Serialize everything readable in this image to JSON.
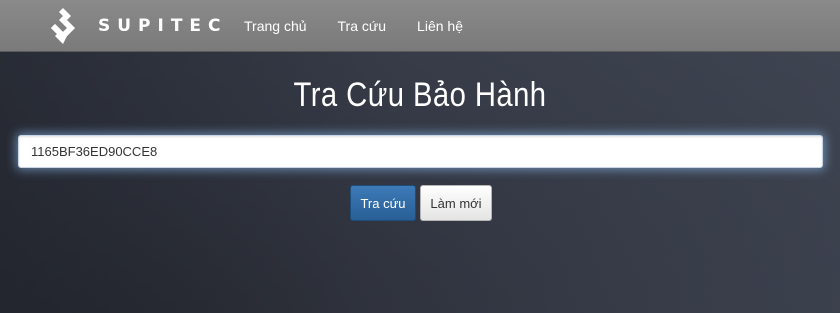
{
  "navbar": {
    "brand_name": "SUPITEC",
    "logo_icon": "supitec-diamond-logo-icon",
    "links": [
      {
        "label": "Trang chủ"
      },
      {
        "label": "Tra cứu"
      },
      {
        "label": "Liên hệ"
      }
    ]
  },
  "main": {
    "title": "Tra Cứu Bảo Hành",
    "search": {
      "value": "1165BF36ED90CCE8",
      "placeholder": ""
    },
    "buttons": {
      "search_label": "Tra cứu",
      "reset_label": "Làm mới"
    }
  },
  "colors": {
    "navbar_bg": "#808080",
    "page_bg": "#3a3f4b",
    "primary_button": "#2f6aa6",
    "input_glow": "#96c8ff"
  }
}
